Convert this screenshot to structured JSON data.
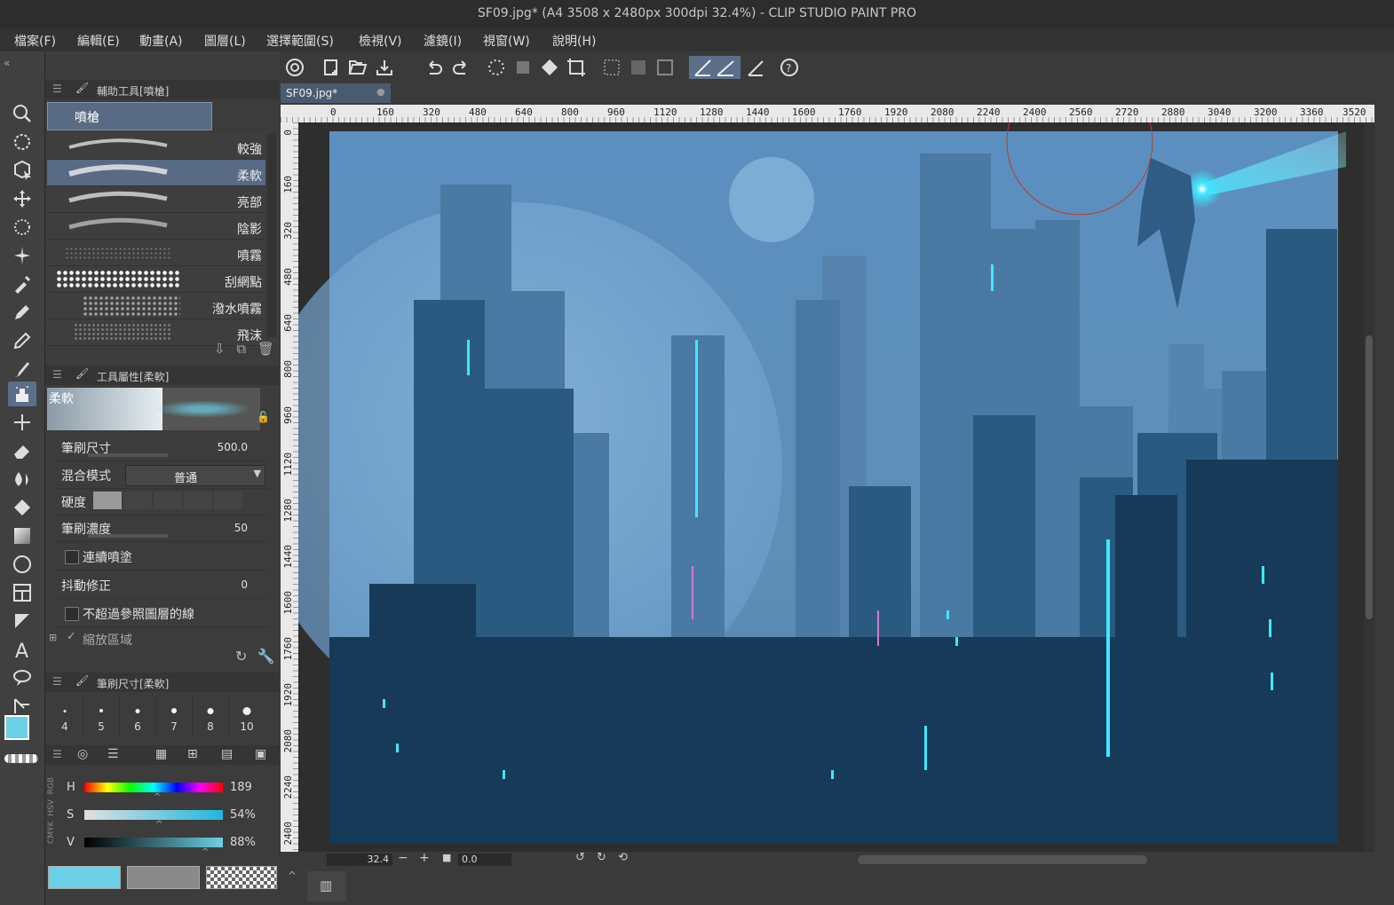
{
  "window": {
    "title": "SF09.jpg* (A4 3508 x 2480px 300dpi 32.4%)  - CLIP STUDIO PAINT PRO"
  },
  "menu": [
    "檔案(F)",
    "編輯(E)",
    "動畫(A)",
    "圖層(L)",
    "選擇範圍(S)",
    "檢視(V)",
    "濾鏡(I)",
    "視窗(W)",
    "說明(H)"
  ],
  "sub_tool_panel": {
    "title": "輔助工具[噴槍]",
    "group_tab": "噴槍",
    "brushes": [
      "較強",
      "柔軟",
      "亮部",
      "陰影",
      "噴霧",
      "刮網點",
      "潑水噴霧",
      "飛沫"
    ]
  },
  "tool_property": {
    "title": "工具屬性[柔軟]",
    "preview_label": "柔軟",
    "brush_size_label": "筆刷尺寸",
    "brush_size_value": "500.0",
    "blend_mode_label": "混合模式",
    "blend_mode_value": "普通",
    "hardness_label": "硬度",
    "density_label": "筆刷濃度",
    "density_value": "50",
    "continuous_label": "連續噴塗",
    "stabilization_label": "抖動修正",
    "stabilization_value": "0",
    "ref_layer_label": "不超過參照圖層的線",
    "zoom_area_label": "縮放區域"
  },
  "brush_size_panel": {
    "title": "筆刷尺寸[柔軟]",
    "sizes": [
      "4",
      "5",
      "6",
      "7",
      "8",
      "10"
    ]
  },
  "color_panel": {
    "tabs": [
      "RGB",
      "HSV",
      "CMYK"
    ],
    "h_label": "H",
    "h_value": "189",
    "s_label": "S",
    "s_value": "54%",
    "v_label": "V",
    "v_value": "88%",
    "main_color": "#6bd0e6",
    "sub_color": "#8a8a8a"
  },
  "document": {
    "tab_label": "SF09.jpg*"
  },
  "ruler": {
    "top": [
      "0",
      "160",
      "320",
      "480",
      "640",
      "800",
      "960",
      "1120",
      "1280",
      "1440",
      "1600",
      "1760",
      "1920",
      "2080",
      "2240",
      "2400",
      "2560",
      "2720",
      "2880",
      "3040",
      "3200",
      "3360",
      "3520"
    ],
    "left": [
      "0",
      "160",
      "320",
      "480",
      "640",
      "800",
      "960",
      "1120",
      "1280",
      "1440",
      "1600",
      "1760",
      "1920",
      "2080",
      "2240",
      "2400"
    ]
  },
  "status": {
    "zoom": "32.4",
    "rotation": "0.0"
  },
  "colors": {
    "accent": "#5b6f8a",
    "canvas_sky": "#5f8db8",
    "neon": "#3de8ff"
  }
}
